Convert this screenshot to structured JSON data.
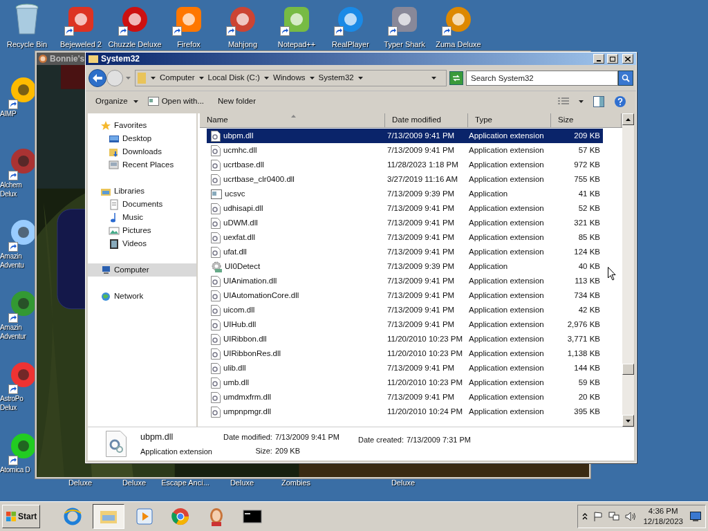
{
  "desktop_icons_top": [
    {
      "label": "Recycle Bin",
      "shortcut": false
    },
    {
      "label": "Bejeweled 2",
      "shortcut": true
    },
    {
      "label": "Chuzzle Deluxe",
      "shortcut": true
    },
    {
      "label": "Firefox",
      "shortcut": true
    },
    {
      "label": "Mahjong",
      "shortcut": true
    },
    {
      "label": "Notepad++",
      "shortcut": true
    },
    {
      "label": "RealPlayer",
      "shortcut": true
    },
    {
      "label": "Typer Shark",
      "shortcut": true
    },
    {
      "label": "Zuma Deluxe",
      "shortcut": true
    }
  ],
  "desktop_icons_left": [
    {
      "lines": [
        "AIMP"
      ]
    },
    {
      "lines": [
        "Alchem",
        "Delux"
      ]
    },
    {
      "lines": [
        "Amazin",
        "Adventu"
      ]
    },
    {
      "lines": [
        "Amazin",
        "Adventur"
      ]
    },
    {
      "lines": [
        "AstroPo",
        "Delux"
      ]
    },
    {
      "lines": [
        "Atomica D"
      ]
    }
  ],
  "desktop_labels_bottom": [
    "Deluxe",
    "Deluxe",
    "Escape Anci...",
    "Deluxe",
    "Zombies",
    "Deluxe"
  ],
  "game_window": {
    "title": "Bonnie's"
  },
  "explorer": {
    "title": "System32",
    "breadcrumb": [
      "Computer",
      "Local Disk (C:)",
      "Windows",
      "System32"
    ],
    "search": {
      "placeholder": "Search System32"
    },
    "toolbar": [
      "Organize",
      "Open with...",
      "New folder"
    ],
    "nav": [
      {
        "label": "Favorites",
        "kind": "favorites",
        "selected": false,
        "children": [
          {
            "label": "Desktop",
            "kind": "desktop",
            "selected": false
          },
          {
            "label": "Downloads",
            "kind": "downloads",
            "selected": false
          },
          {
            "label": "Recent Places",
            "kind": "recent",
            "selected": false
          }
        ]
      },
      {
        "label": "Libraries",
        "kind": "libraries",
        "selected": false,
        "children": [
          {
            "label": "Documents",
            "kind": "documents",
            "selected": false
          },
          {
            "label": "Music",
            "kind": "music",
            "selected": false
          },
          {
            "label": "Pictures",
            "kind": "pictures",
            "selected": false
          },
          {
            "label": "Videos",
            "kind": "videos",
            "selected": false
          }
        ]
      },
      {
        "label": "Computer",
        "kind": "computer",
        "selected": true
      },
      {
        "label": "Network",
        "kind": "network",
        "selected": false
      }
    ],
    "columns": [
      "Name",
      "Date modified",
      "Type",
      "Size"
    ],
    "rows": [
      {
        "name": "ubpm.dll",
        "date": "7/13/2009 9:41 PM",
        "type": "Application extension",
        "size": "209 KB",
        "kind": "dll",
        "selected": true
      },
      {
        "name": "ucmhc.dll",
        "date": "7/13/2009 9:41 PM",
        "type": "Application extension",
        "size": "57 KB",
        "kind": "dll",
        "selected": false
      },
      {
        "name": "ucrtbase.dll",
        "date": "11/28/2023 1:18 PM",
        "type": "Application extension",
        "size": "972 KB",
        "kind": "dll",
        "selected": false
      },
      {
        "name": "ucrtbase_clr0400.dll",
        "date": "3/27/2019 11:16 AM",
        "type": "Application extension",
        "size": "755 KB",
        "kind": "dll",
        "selected": false
      },
      {
        "name": "ucsvc",
        "date": "7/13/2009 9:39 PM",
        "type": "Application",
        "size": "41 KB",
        "kind": "app",
        "selected": false
      },
      {
        "name": "udhisapi.dll",
        "date": "7/13/2009 9:41 PM",
        "type": "Application extension",
        "size": "52 KB",
        "kind": "dll",
        "selected": false
      },
      {
        "name": "uDWM.dll",
        "date": "7/13/2009 9:41 PM",
        "type": "Application extension",
        "size": "321 KB",
        "kind": "dll",
        "selected": false
      },
      {
        "name": "uexfat.dll",
        "date": "7/13/2009 9:41 PM",
        "type": "Application extension",
        "size": "85 KB",
        "kind": "dll",
        "selected": false
      },
      {
        "name": "ufat.dll",
        "date": "7/13/2009 9:41 PM",
        "type": "Application extension",
        "size": "124 KB",
        "kind": "dll",
        "selected": false
      },
      {
        "name": "UI0Detect",
        "date": "7/13/2009 9:39 PM",
        "type": "Application",
        "size": "40 KB",
        "kind": "service",
        "selected": false
      },
      {
        "name": "UIAnimation.dll",
        "date": "7/13/2009 9:41 PM",
        "type": "Application extension",
        "size": "113 KB",
        "kind": "dll",
        "selected": false
      },
      {
        "name": "UIAutomationCore.dll",
        "date": "7/13/2009 9:41 PM",
        "type": "Application extension",
        "size": "734 KB",
        "kind": "dll",
        "selected": false
      },
      {
        "name": "uicom.dll",
        "date": "7/13/2009 9:41 PM",
        "type": "Application extension",
        "size": "42 KB",
        "kind": "dll",
        "selected": false
      },
      {
        "name": "UIHub.dll",
        "date": "7/13/2009 9:41 PM",
        "type": "Application extension",
        "size": "2,976 KB",
        "kind": "dll",
        "selected": false
      },
      {
        "name": "UIRibbon.dll",
        "date": "11/20/2010 10:23 PM",
        "type": "Application extension",
        "size": "3,771 KB",
        "kind": "dll",
        "selected": false
      },
      {
        "name": "UIRibbonRes.dll",
        "date": "11/20/2010 10:23 PM",
        "type": "Application extension",
        "size": "1,138 KB",
        "kind": "dll",
        "selected": false
      },
      {
        "name": "ulib.dll",
        "date": "7/13/2009 9:41 PM",
        "type": "Application extension",
        "size": "144 KB",
        "kind": "dll",
        "selected": false
      },
      {
        "name": "umb.dll",
        "date": "11/20/2010 10:23 PM",
        "type": "Application extension",
        "size": "59 KB",
        "kind": "dll",
        "selected": false
      },
      {
        "name": "umdmxfrm.dll",
        "date": "7/13/2009 9:41 PM",
        "type": "Application extension",
        "size": "20 KB",
        "kind": "dll",
        "selected": false
      },
      {
        "name": "umpnpmgr.dll",
        "date": "11/20/2010 10:24 PM",
        "type": "Application extension",
        "size": "395 KB",
        "kind": "dll",
        "selected": false
      }
    ],
    "details": {
      "name": "ubpm.dll",
      "type": "Application extension",
      "modified_label": "Date modified:",
      "modified": "7/13/2009 9:41 PM",
      "size_label": "Size:",
      "size": "209 KB",
      "created_label": "Date created:",
      "created": "7/13/2009 7:31 PM"
    }
  },
  "taskbar": {
    "start": "Start",
    "apps": [
      {
        "kind": "ie",
        "selected": false
      },
      {
        "kind": "explorer",
        "selected": true
      },
      {
        "kind": "media",
        "selected": false
      },
      {
        "kind": "chrome",
        "selected": false
      },
      {
        "kind": "avatar",
        "selected": false
      },
      {
        "kind": "console",
        "selected": false
      }
    ],
    "time": "4:36 PM",
    "date": "12/18/2023"
  }
}
